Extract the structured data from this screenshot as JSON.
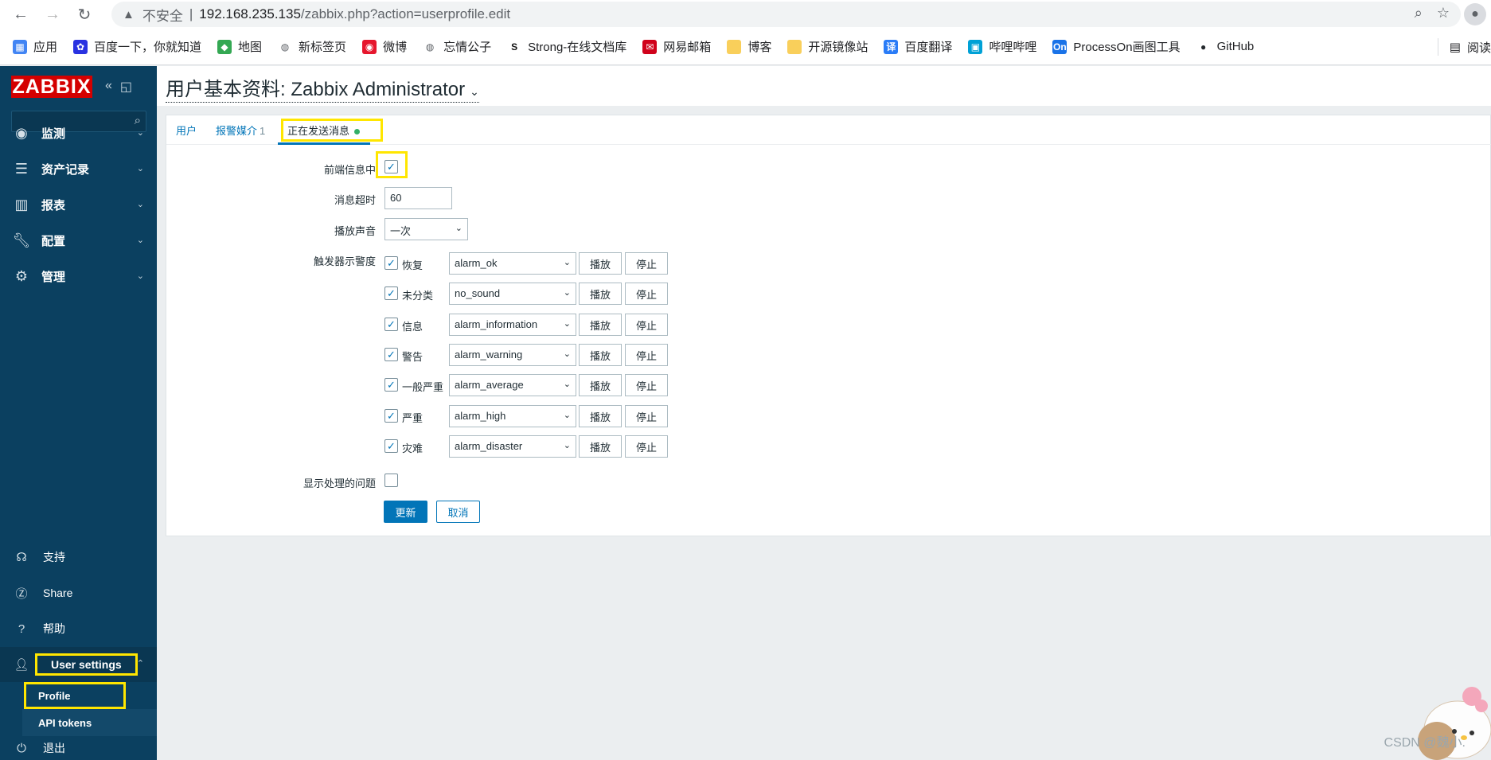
{
  "browser": {
    "insecure_label": "不安全",
    "url_host": "192.168.235.135",
    "url_path": "/zabbix.php?action=userprofile.edit"
  },
  "bookmarks": [
    {
      "label": "应用",
      "icon": "apps-grid-icon",
      "color": "#4285f4"
    },
    {
      "label": "百度一下，你就知道",
      "icon": "baidu-icon",
      "color": "#2932e1"
    },
    {
      "label": "地图",
      "icon": "maps-icon",
      "color": "#34a853"
    },
    {
      "label": "新标签页",
      "icon": "globe-icon",
      "color": "#5f6368"
    },
    {
      "label": "微博",
      "icon": "weibo-icon",
      "color": "#e6162d"
    },
    {
      "label": "忘情公子",
      "icon": "globe-icon",
      "color": "#5f6368"
    },
    {
      "label": "Strong-在线文档库",
      "icon": "strong-icon",
      "color": "#111111"
    },
    {
      "label": "网易邮箱",
      "icon": "netease-icon",
      "color": "#d0021b"
    },
    {
      "label": "博客",
      "icon": "folder-icon",
      "color": "#f9cf5b"
    },
    {
      "label": "开源镜像站",
      "icon": "folder-icon",
      "color": "#f9cf5b"
    },
    {
      "label": "百度翻译",
      "icon": "translate-icon",
      "color": "#2a7cf7"
    },
    {
      "label": "哔哩哔哩",
      "icon": "bilibili-icon",
      "color": "#00a1d6"
    },
    {
      "label": "ProcessOn画图工具",
      "icon": "processon-icon",
      "color": "#1a73e8"
    },
    {
      "label": "GitHub",
      "icon": "github-icon",
      "color": "#24292e"
    }
  ],
  "reading_list": "阅读",
  "sidebar": {
    "logo": "ZABBIX",
    "menu": [
      {
        "label": "监测",
        "icon": "eye-icon"
      },
      {
        "label": "资产记录",
        "icon": "list-icon"
      },
      {
        "label": "报表",
        "icon": "bar-chart-icon"
      },
      {
        "label": "配置",
        "icon": "wrench-icon"
      },
      {
        "label": "管理",
        "icon": "gear-icon"
      }
    ],
    "bottom": [
      {
        "label": "支持",
        "icon": "headset-icon"
      },
      {
        "label": "Share",
        "icon": "share-z-icon"
      },
      {
        "label": "帮助",
        "icon": "help-icon"
      }
    ],
    "user_settings": "User settings",
    "sub_items": [
      "Profile",
      "API tokens"
    ],
    "logout": "退出"
  },
  "page": {
    "title": "用户基本资料: Zabbix Administrator"
  },
  "tabs": [
    {
      "label": "用户",
      "count": ""
    },
    {
      "label": "报警媒介",
      "count": "1"
    },
    {
      "label": "正在发送消息",
      "count": ""
    }
  ],
  "form": {
    "frontend_messaging_label": "前端信息中",
    "frontend_messaging_checked": true,
    "timeout_label": "消息超时",
    "timeout_value": "60",
    "play_sound_label": "播放声音",
    "play_sound_value": "一次",
    "trigger_severity_label": "触发器示警度",
    "severities": [
      {
        "label": "恢复",
        "sound": "alarm_ok",
        "checked": true
      },
      {
        "label": "未分类",
        "sound": "no_sound",
        "checked": true
      },
      {
        "label": "信息",
        "sound": "alarm_information",
        "checked": true
      },
      {
        "label": "警告",
        "sound": "alarm_warning",
        "checked": true
      },
      {
        "label": "一般严重",
        "sound": "alarm_average",
        "checked": true
      },
      {
        "label": "严重",
        "sound": "alarm_high",
        "checked": true
      },
      {
        "label": "灾难",
        "sound": "alarm_disaster",
        "checked": true
      }
    ],
    "play_label": "播放",
    "stop_label": "停止",
    "show_suppressed_label": "显示处理的问题",
    "show_suppressed_checked": false,
    "update_label": "更新",
    "cancel_label": "取消"
  },
  "watermark": "CSDN @魏小.",
  "colors": {
    "sidebar_bg": "#0b4060",
    "logo_red": "#d40000",
    "link_blue": "#0275b8",
    "highlight_yellow": "#ffe600",
    "active_dot": "#34af67"
  }
}
